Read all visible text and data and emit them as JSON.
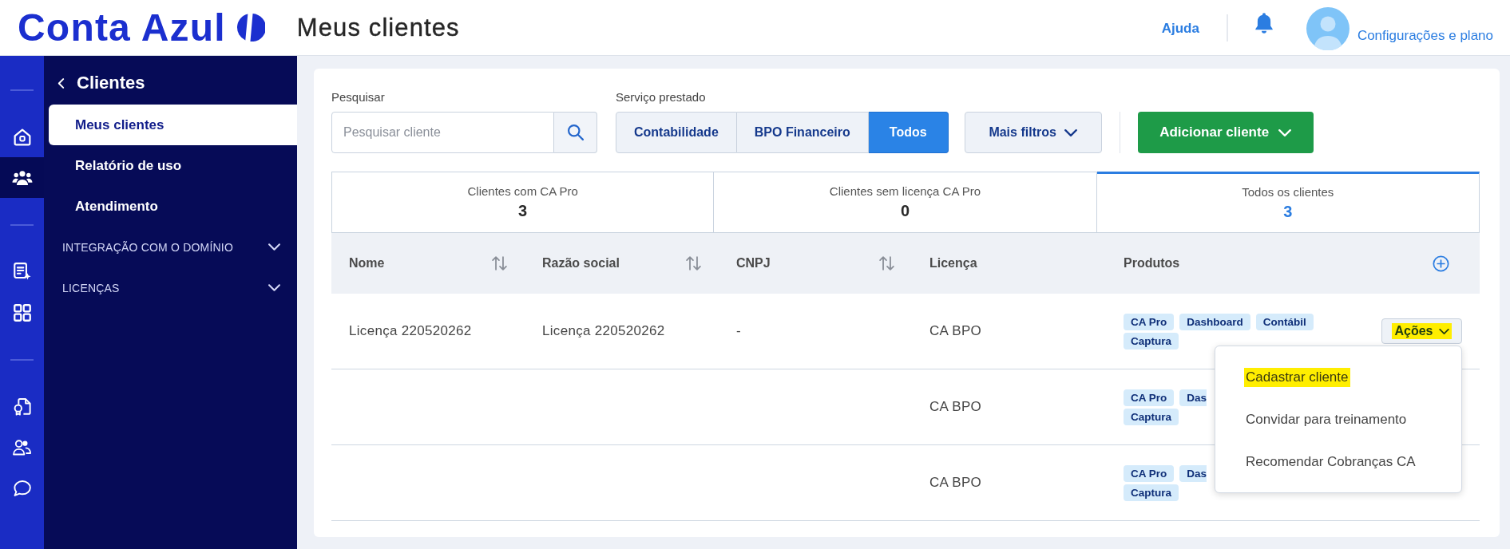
{
  "header": {
    "logo": "Conta Azul",
    "title": "Meus clientes",
    "help_link": "Ajuda",
    "account_link": "Configurações e plano"
  },
  "rail": {
    "groups": [
      {
        "items": [
          {
            "kind": "home",
            "selected": false
          },
          {
            "kind": "people",
            "selected": true
          }
        ]
      },
      {
        "items": [
          {
            "kind": "report",
            "selected": false
          },
          {
            "kind": "apps",
            "selected": false
          }
        ]
      },
      {
        "items": [
          {
            "kind": "certificate",
            "selected": false
          },
          {
            "kind": "contacts",
            "selected": false
          },
          {
            "kind": "chat",
            "selected": false
          }
        ]
      }
    ]
  },
  "sidebar": {
    "title": "Clientes",
    "items": [
      {
        "label": "Meus clientes",
        "selected": true
      },
      {
        "label": "Relatório de uso",
        "selected": false
      },
      {
        "label": "Atendimento",
        "selected": false
      }
    ],
    "sections": [
      {
        "label": "INTEGRAÇÃO COM O DOMÍNIO",
        "expanded": false
      },
      {
        "label": "LICENÇAS",
        "expanded": false
      }
    ]
  },
  "filters": {
    "search": {
      "label": "Pesquisar",
      "placeholder": "Pesquisar cliente"
    },
    "service": {
      "label": "Serviço prestado",
      "options": [
        {
          "label": "Contabilidade",
          "selected": false
        },
        {
          "label": "BPO Financeiro",
          "selected": false
        },
        {
          "label": "Todos",
          "selected": true
        }
      ]
    },
    "more_filters": "Mais filtros",
    "add_client": "Adicionar cliente"
  },
  "summary_tabs": [
    {
      "label": "Clientes com CA Pro",
      "count": "3",
      "selected": false
    },
    {
      "label": "Clientes sem licença CA Pro",
      "count": "0",
      "selected": false
    },
    {
      "label": "Todos os clientes",
      "count": "3",
      "selected": true
    }
  ],
  "table": {
    "columns": [
      {
        "label": "Nome",
        "sortable": true
      },
      {
        "label": "Razão social",
        "sortable": true
      },
      {
        "label": "CNPJ",
        "sortable": true
      },
      {
        "label": "Licença",
        "sortable": false
      },
      {
        "label": "Produtos",
        "sortable": false
      }
    ],
    "rows": [
      {
        "name": "Licença 220520262",
        "company_name": "Licença 220520262",
        "cnpj": "-",
        "license": "CA BPO",
        "products": [
          [
            {
              "label": "CA Pro",
              "cut": false
            },
            {
              "label": "Dashboard",
              "cut": false
            },
            {
              "label": "Contábil",
              "cut": false
            }
          ],
          [
            {
              "label": "Captura",
              "cut": false
            }
          ]
        ],
        "actions": {
          "label": "Ações",
          "highlighted": true
        }
      },
      {
        "license": "CA BPO",
        "products": [
          [
            {
              "label": "CA Pro",
              "cut": false
            },
            {
              "label": "Das",
              "cut": true
            }
          ],
          [
            {
              "label": "Captura",
              "cut": false
            }
          ]
        ]
      },
      {
        "license": "CA BPO",
        "products": [
          [
            {
              "label": "CA Pro",
              "cut": false
            },
            {
              "label": "Das",
              "cut": true
            }
          ],
          [
            {
              "label": "Captura",
              "cut": false
            }
          ]
        ]
      }
    ]
  },
  "actions_menu": {
    "items": [
      {
        "label": "Cadastrar cliente",
        "highlighted": true
      },
      {
        "label": "Convidar para treinamento",
        "highlighted": false
      },
      {
        "label": "Recomendar Cobranças CA",
        "highlighted": false
      }
    ]
  }
}
